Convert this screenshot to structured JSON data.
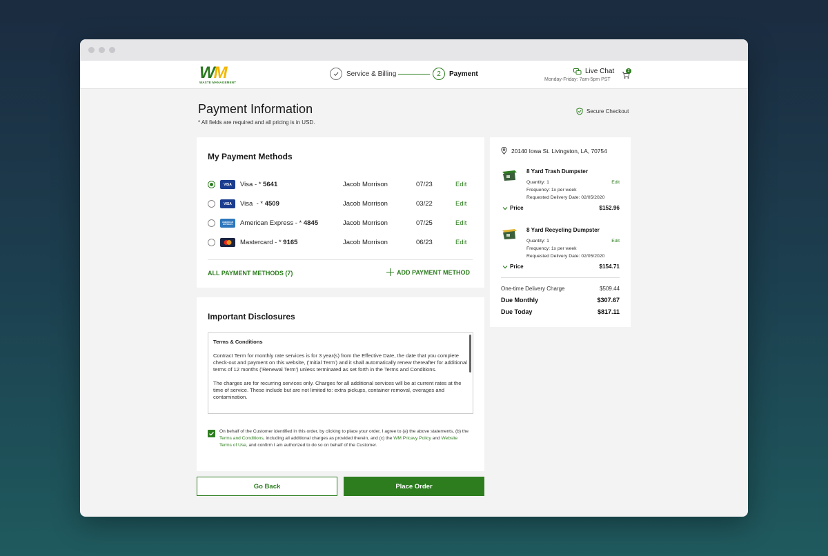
{
  "brand": {
    "logo_text_w": "W",
    "logo_text_m": "M",
    "logo_tagline": "WASTE MANAGEMENT",
    "accent": "#2d7d1f",
    "accent_yellow": "#f2b705"
  },
  "steps": [
    {
      "number": "✓",
      "label": "Service & Billing",
      "state": "complete"
    },
    {
      "number": "2",
      "label": "Payment",
      "state": "active"
    }
  ],
  "header": {
    "live_chat": "Live Chat",
    "hours": "Monday-Friday: 7am-5pm PST",
    "cart_count": "2"
  },
  "page": {
    "title": "Payment Information",
    "subtitle": "* All fields are required and all pricing is in USD.",
    "secure": "Secure Checkout"
  },
  "payment_methods": {
    "heading": "My Payment Methods",
    "rows": [
      {
        "brand": "VISA",
        "brand_color": "#1a3d8f",
        "prefix": "Visa - * ",
        "last4": "5641",
        "holder": "Jacob Morrison",
        "exp": "07/23",
        "edit": "Edit",
        "selected": true
      },
      {
        "brand": "VISA",
        "brand_color": "#1a3d8f",
        "prefix": "Visa  - * ",
        "last4": "4509",
        "holder": "Jacob Morrison",
        "exp": "03/22",
        "edit": "Edit",
        "selected": false
      },
      {
        "brand": "AMERICAN EXPRESS",
        "brand_color": "#2e77bc",
        "prefix": "American Express - * ",
        "last4": "4845",
        "holder": "Jacob Morrison",
        "exp": "07/25",
        "edit": "Edit",
        "selected": false
      },
      {
        "brand": "",
        "brand_color": "#1b2340",
        "prefix": "Mastercard - * ",
        "last4": "9165",
        "holder": "Jacob Morrison",
        "exp": "06/23",
        "edit": "Edit",
        "selected": false
      }
    ],
    "all_link": "ALL PAYMENT METHODS (7)",
    "add_link": "ADD PAYMENT METHOD"
  },
  "disclosures": {
    "heading": "Important Disclosures",
    "terms_title": "Terms & Conditions",
    "paragraph_1": "Contract Term for monthly rate services is for 3 year(s) from the Effective Date, the date that you complete check-out and payment on this website, ('Initial Term') and it shall automatically renew thereafter for additional terms of 12 months ('Renewal Term') unless terminated as set forth in the Terms and Conditions.",
    "paragraph_2": "The charges are for recurring services only. Charges for all additional services will be at current rates at the time of service. These include but are not limited to: extra pickups, container removal, overages and contamination.",
    "agree_1": "On behalf of the Customer identified in this order, by clicking to place your order, I agree to (a) the above statements, (b) the ",
    "agree_link_1": "Terms and Conditions",
    "agree_2": ", including all additional charges as provided therein, and (c) the ",
    "agree_link_2": "WM Pricavy Policy",
    "agree_3": " and ",
    "agree_link_3": "Website Terms of Use",
    "agree_4": ", and confirm I am authorized to do so on behalf of the Customer.",
    "checked": true
  },
  "buttons": {
    "back": "Go Back",
    "place_order": "Place Order"
  },
  "summary": {
    "address": "20140 Iowa St. Livingston, LA, 70754",
    "items": [
      {
        "name": "8 Yard Trash Dumpster",
        "quantity": "Quantity: 1",
        "frequency": "Frequency: 1x per week",
        "delivery": "Requested Delivery Date: 02/05/2020",
        "edit": "Edit",
        "price_label": "Price",
        "price": "$152.96",
        "lid_color": "#2d7d1f"
      },
      {
        "name": "8 Yard Recycling Dumpster",
        "quantity": "Quantity: 1",
        "frequency": "Frequency: 1x per week",
        "delivery": "Requested Delivery Date: 02/05/2020",
        "edit": "Edit",
        "price_label": "Price",
        "price": "$154.71",
        "lid_color": "#e0b431"
      }
    ],
    "delivery_label": "One-time Delivery Charge",
    "delivery_value": "$509.44",
    "monthly_label": "Due Monthly",
    "monthly_value": "$307.67",
    "today_label": "Due Today",
    "today_value": "$817.11"
  }
}
